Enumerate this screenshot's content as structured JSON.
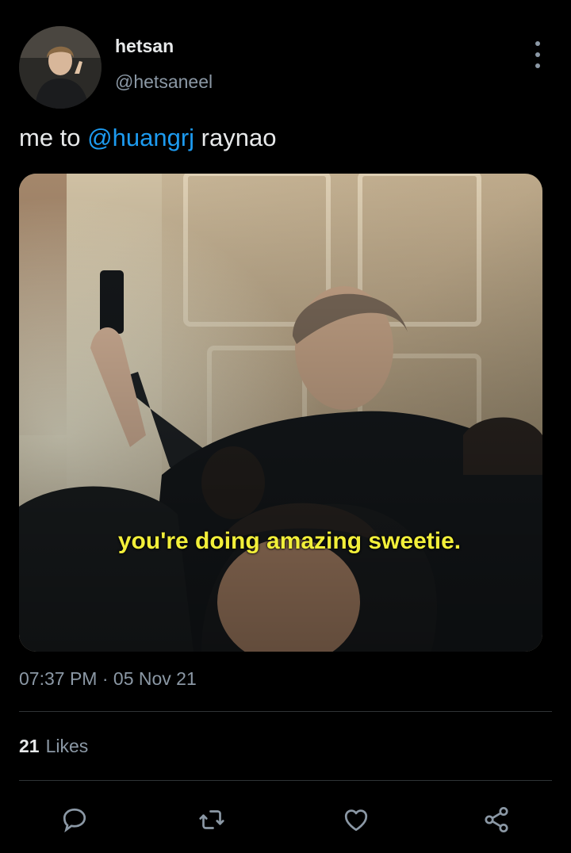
{
  "author": {
    "display_name": "hetsan",
    "handle": "@hetsaneel"
  },
  "tweet": {
    "text_before": "me to ",
    "mention": "@huangrj",
    "text_after": " raynao",
    "media_caption": "you're doing amazing sweetie."
  },
  "meta": {
    "time": "07:37 PM",
    "separator": " · ",
    "date": "05 Nov 21"
  },
  "stats": {
    "likes_count": "21",
    "likes_label": "Likes"
  },
  "icons": {
    "more": "more-vertical-icon",
    "reply": "reply-icon",
    "retweet": "retweet-icon",
    "like": "heart-icon",
    "share": "share-icon"
  },
  "colors": {
    "background": "#000000",
    "mention": "#1d9bf0",
    "secondary_text": "#8b98a5",
    "caption": "#f2ef3a"
  }
}
